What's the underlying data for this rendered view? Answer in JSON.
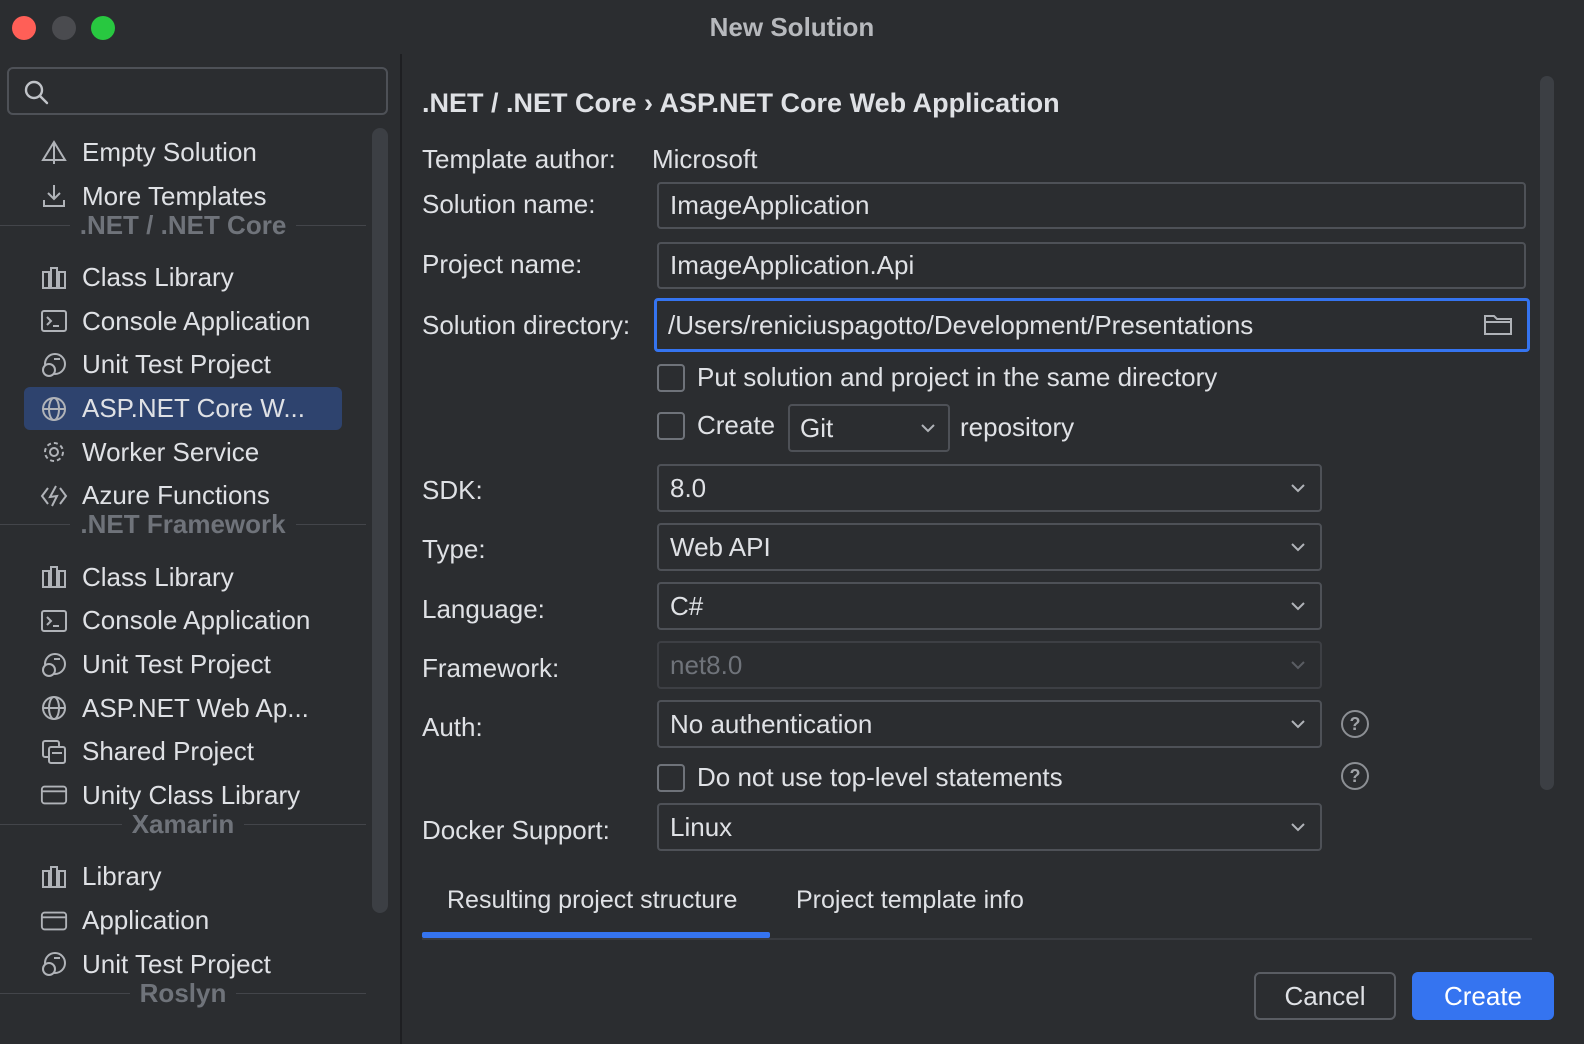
{
  "window": {
    "title": "New Solution"
  },
  "sidebar": {
    "search_value": "",
    "items": [
      {
        "type": "item",
        "label": "Empty Solution",
        "icon": "empty-solution-icon"
      },
      {
        "type": "item",
        "label": "More Templates",
        "icon": "download-icon"
      },
      {
        "type": "group",
        "label": ".NET / .NET Core"
      },
      {
        "type": "item",
        "label": "Class Library",
        "icon": "library-icon"
      },
      {
        "type": "item",
        "label": "Console Application",
        "icon": "console-icon"
      },
      {
        "type": "item",
        "label": "Unit Test Project",
        "icon": "unit-test-icon"
      },
      {
        "type": "item",
        "label": "ASP.NET Core W...",
        "icon": "globe-icon",
        "selected": true
      },
      {
        "type": "item",
        "label": "Worker Service",
        "icon": "gear-icon"
      },
      {
        "type": "item",
        "label": "Azure Functions",
        "icon": "azure-functions-icon"
      },
      {
        "type": "group",
        "label": ".NET Framework"
      },
      {
        "type": "item",
        "label": "Class Library",
        "icon": "library-icon"
      },
      {
        "type": "item",
        "label": "Console Application",
        "icon": "console-icon"
      },
      {
        "type": "item",
        "label": "Unit Test Project",
        "icon": "unit-test-icon"
      },
      {
        "type": "item",
        "label": "ASP.NET Web Ap...",
        "icon": "globe-icon"
      },
      {
        "type": "item",
        "label": "Shared Project",
        "icon": "shared-project-icon"
      },
      {
        "type": "item",
        "label": "Unity Class Library",
        "icon": "window-icon"
      },
      {
        "type": "group",
        "label": "Xamarin"
      },
      {
        "type": "item",
        "label": "Library",
        "icon": "library-icon"
      },
      {
        "type": "item",
        "label": "Application",
        "icon": "window-icon"
      },
      {
        "type": "item",
        "label": "Unit Test Project",
        "icon": "unit-test-icon"
      },
      {
        "type": "group",
        "label": "Roslyn"
      }
    ]
  },
  "main": {
    "breadcrumb": ".NET / .NET Core › ASP.NET Core Web Application",
    "template_author_label": "Template author:",
    "template_author_value": "Microsoft",
    "solution_name_label": "Solution name:",
    "solution_name_value": "ImageApplication",
    "project_name_label": "Project name:",
    "project_name_value": "ImageApplication.Api",
    "solution_directory_label": "Solution directory:",
    "solution_directory_value": "/Users/reniciuspagotto/Development/Presentations",
    "same_directory_label": "Put solution and project in the same directory",
    "create_label": "Create",
    "git_value": "Git",
    "repository_label": "repository",
    "sdk_label": "SDK:",
    "sdk_value": "8.0",
    "type_label": "Type:",
    "type_value": "Web API",
    "language_label": "Language:",
    "language_value": "C#",
    "framework_label": "Framework:",
    "framework_value": "net8.0",
    "auth_label": "Auth:",
    "auth_value": "No authentication",
    "top_level_label": "Do not use top-level statements",
    "docker_label": "Docker Support:",
    "docker_value": "Linux",
    "help_glyph": "?"
  },
  "tabs": {
    "structure": "Resulting project structure",
    "info": "Project template info"
  },
  "footer": {
    "cancel": "Cancel",
    "create": "Create"
  },
  "colors": {
    "accent": "#3574f0",
    "selection": "#2e436e",
    "background": "#2b2d30"
  }
}
